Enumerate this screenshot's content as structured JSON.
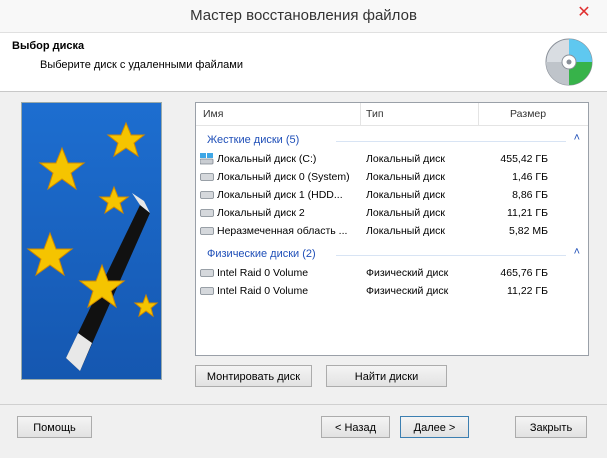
{
  "window": {
    "title": "Мастер восстановления файлов",
    "close_glyph": "✕"
  },
  "header": {
    "title": "Выбор диска",
    "subtitle": "Выберите диск с удаленными файлами",
    "icon": "disk-recovery-icon"
  },
  "wizard_image": {
    "icon": "magic-wand-stars-icon"
  },
  "list": {
    "columns": [
      "Имя",
      "Тип",
      "Размер"
    ],
    "groups": [
      {
        "label": "Жесткие диски (5)",
        "rows": [
          {
            "name": "Локальный диск (C:)",
            "type": "Локальный диск",
            "size": "455,42 ГБ",
            "icon": "system-drive-icon"
          },
          {
            "name": "Локальный диск 0 (System)",
            "type": "Локальный диск",
            "size": "1,46 ГБ",
            "icon": "drive-icon"
          },
          {
            "name": "Локальный диск 1 (HDD...",
            "type": "Локальный диск",
            "size": "8,86 ГБ",
            "icon": "drive-icon"
          },
          {
            "name": "Локальный диск 2",
            "type": "Локальный диск",
            "size": "11,21 ГБ",
            "icon": "drive-icon"
          },
          {
            "name": "Неразмеченная область ...",
            "type": "Локальный диск",
            "size": "5,82 МБ",
            "icon": "drive-icon"
          }
        ]
      },
      {
        "label": "Физические диски (2)",
        "rows": [
          {
            "name": "Intel Raid 0 Volume",
            "type": "Физический диск",
            "size": "465,76 ГБ",
            "icon": "drive-icon"
          },
          {
            "name": "Intel Raid 0 Volume",
            "type": "Физический диск",
            "size": "11,22 ГБ",
            "icon": "drive-icon"
          }
        ]
      }
    ],
    "collapse_glyph": "˄"
  },
  "buttons": {
    "mount": "Монтировать диск",
    "find": "Найти диски",
    "help": "Помощь",
    "back": "< Назад",
    "next": "Далее >",
    "close": "Закрыть"
  }
}
